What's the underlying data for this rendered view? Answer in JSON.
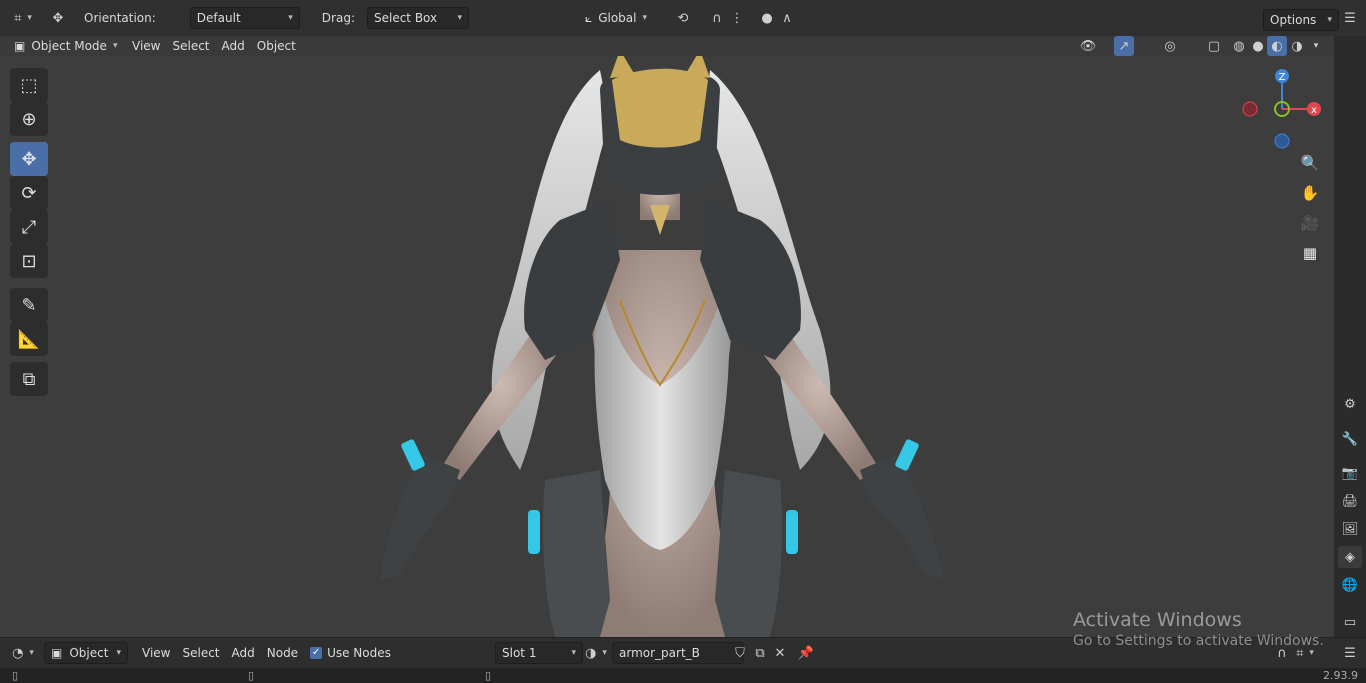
{
  "topbar": {
    "orientation_label": "Orientation:",
    "orientation_value": "Default",
    "drag_label": "Drag:",
    "drag_value": "Select Box",
    "transform_space": "Global",
    "options": "Options"
  },
  "header": {
    "mode": "Object Mode",
    "menus": [
      "View",
      "Select",
      "Add",
      "Object"
    ]
  },
  "gizmo": {
    "z": "Z"
  },
  "node_editor": {
    "type": "Object",
    "menus": [
      "View",
      "Select",
      "Add",
      "Node"
    ],
    "use_nodes_label": "Use Nodes",
    "use_nodes_checked": true,
    "slot": "Slot 1",
    "material_name": "armor_part_B"
  },
  "status": {
    "version": "2.93.9"
  },
  "watermark": {
    "title": "Activate Windows",
    "subtitle": "Go to Settings to activate Windows."
  },
  "colors": {
    "accent": "#4a6fa8",
    "axis_x": "#e0484f",
    "axis_y": "#8bbd2c",
    "axis_z": "#3f85d8"
  },
  "icons": [
    "editor-type-icon",
    "move-icon",
    "cursor-icon",
    "rotate-icon",
    "scale-icon",
    "transform-icon",
    "annotate-icon",
    "measure-icon",
    "add-cube-icon",
    "zoom-icon",
    "hand-icon",
    "camera-icon",
    "grid-icon"
  ]
}
